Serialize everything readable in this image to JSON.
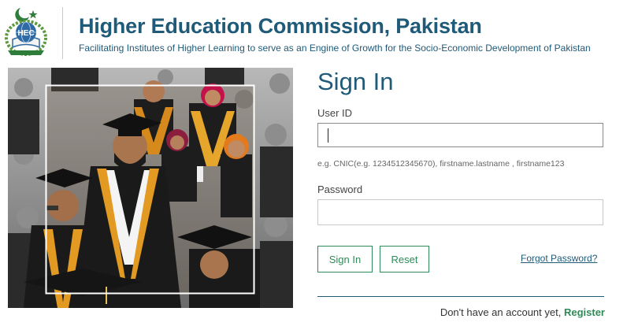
{
  "header": {
    "logo_text": "HEC",
    "title": "Higher Education Commission, Pakistan",
    "tagline": "Facilitating Institutes of Higher Learning to serve as an Engine of Growth for the Socio-Economic Development of Pakistan"
  },
  "form": {
    "title": "Sign In",
    "userid_label": "User ID",
    "userid_value": "",
    "userid_hint": "e.g. CNIC(e.g. 1234512345670), firstname.lastname , firstname123",
    "password_label": "Password",
    "password_value": "",
    "signin_label": "Sign In",
    "reset_label": "Reset",
    "forgot_label": "Forgot Password?"
  },
  "footer": {
    "no_account_text": "Don't have an account yet,",
    "register_label": "Register"
  },
  "colors": {
    "brand_blue": "#1f5a78",
    "action_green": "#2e8b57"
  }
}
